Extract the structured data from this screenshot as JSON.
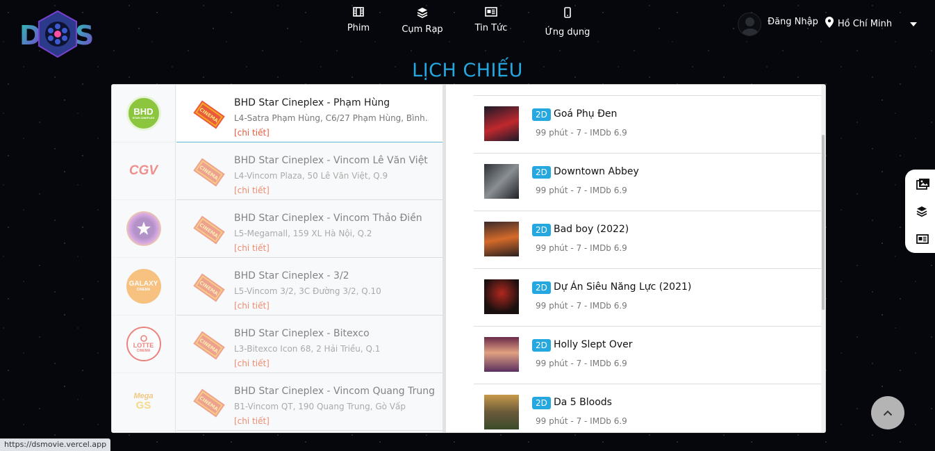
{
  "header": {
    "logo_text": "DS",
    "nav": [
      {
        "label": "Phim",
        "icon": "film-icon"
      },
      {
        "label": "Cụm Rạp",
        "icon": "layers-icon"
      },
      {
        "label": "Tin Tức",
        "icon": "newspaper-icon"
      },
      {
        "label": "Ứng dụng",
        "icon": "mobile-icon"
      }
    ],
    "login_label": "Đăng Nhập",
    "city": "Hồ Chí Minh"
  },
  "page_title": "LỊCH CHIẾU",
  "brands": [
    {
      "name": "BHD",
      "sub": "STAR CINEPLEX",
      "color": "#8cc63f",
      "active": true
    },
    {
      "name": "CGV",
      "color": "#e53935",
      "active": false
    },
    {
      "name": "CineStar",
      "color": "#7b3fa0",
      "active": false
    },
    {
      "name": "GALAXY",
      "sub": "CINEMA",
      "color": "#f7941d",
      "active": false
    },
    {
      "name": "LOTTE",
      "sub": "CINEMA",
      "color": "#e2231a",
      "active": false
    },
    {
      "name": "Mega",
      "sub": "GS",
      "color": "#f5a623",
      "active": false
    }
  ],
  "cinemas": [
    {
      "name": "BHD Star Cineplex - Phạm Hùng",
      "address": "L4-Satra Phạm Hùng, C6/27 Phạm Hùng, Bình...",
      "detail": "[chi tiết]",
      "active": true
    },
    {
      "name": "BHD Star Cineplex - Vincom Lê Văn Việt",
      "address": "L4-Vincom Plaza, 50 Lê Văn Việt, Q.9",
      "detail": "[chi tiết]",
      "active": false
    },
    {
      "name": "BHD Star Cineplex - Vincom Thảo Điền",
      "address": "L5-Megamall, 159 XL Hà Nội, Q.2",
      "detail": "[chi tiết]",
      "active": false
    },
    {
      "name": "BHD Star Cineplex - 3/2",
      "address": "L5-Vincom 3/2, 3C Đường 3/2, Q.10",
      "detail": "[chi tiết]",
      "active": false
    },
    {
      "name": "BHD Star Cineplex - Bitexco",
      "address": "L3-Bitexco Icon 68, 2 Hải Triều, Q.1",
      "detail": "[chi tiết]",
      "active": false
    },
    {
      "name": "BHD Star Cineplex - Vincom Quang Trung",
      "address": "B1-Vincom QT, 190 Quang Trung, Gò Vấp",
      "detail": "[chi tiết]",
      "active": false
    }
  ],
  "cinema_icon_text": "CINEMA",
  "movies": [
    {
      "badge": "2D",
      "title": "Goá Phụ Đen",
      "meta": "99 phút - 7 - IMDb 6.9",
      "poster_colors": [
        "#1a1a2a",
        "#c0282d"
      ]
    },
    {
      "badge": "2D",
      "title": "Downtown Abbey",
      "meta": "99 phút - 7 - IMDb 6.9",
      "poster_colors": [
        "#2e3236",
        "#8a8f94"
      ]
    },
    {
      "badge": "2D",
      "title": "Bad boy (2022)",
      "meta": "99 phút - 7 - IMDb 6.9",
      "poster_colors": [
        "#3a2a2a",
        "#d46a2a"
      ]
    },
    {
      "badge": "2D",
      "title": "Dự Án Siêu Năng Lực (2021)",
      "meta": "99 phút - 7 - IMDb 6.9",
      "poster_colors": [
        "#1a1010",
        "#b0281e"
      ]
    },
    {
      "badge": "2D",
      "title": "Holly Slept Over",
      "meta": "99 phút - 7 - IMDb 6.9",
      "poster_colors": [
        "#6a2a4a",
        "#e0a080"
      ]
    },
    {
      "badge": "2D",
      "title": "Da 5 Bloods",
      "meta": "99 phút - 7 - IMDb 6.9",
      "poster_colors": [
        "#c89a4a",
        "#3a4a2a"
      ]
    }
  ],
  "status_url": "https://dsmovie.vercel.app"
}
